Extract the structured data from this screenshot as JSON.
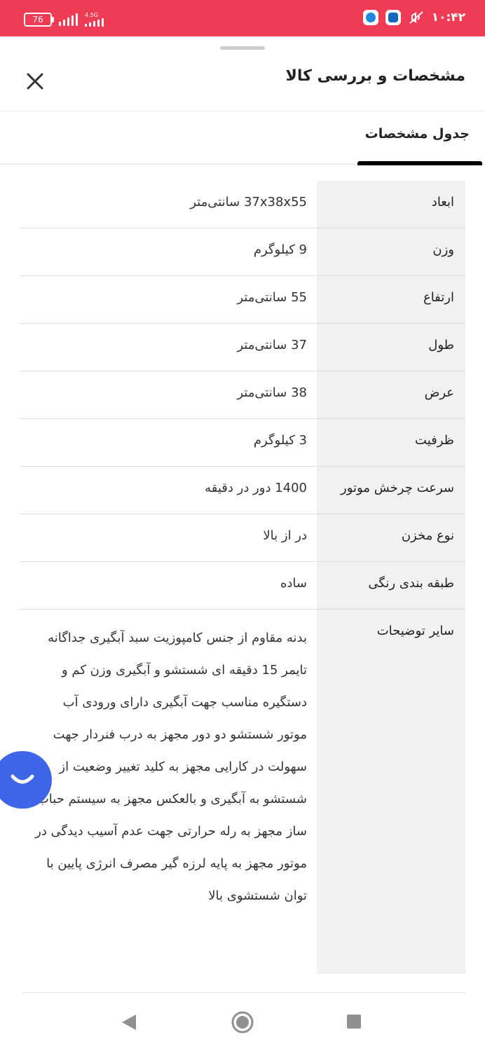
{
  "status_bar": {
    "battery": "76",
    "network": "4.5G",
    "time": "۱۰:۴۲"
  },
  "header": {
    "title": "مشخصات و بررسی کالا"
  },
  "tabs": [
    {
      "label": "جدول مشخصات"
    }
  ],
  "specs": [
    {
      "key": "ابعاد",
      "value": "37x38x55 سانتی‌متر"
    },
    {
      "key": "وزن",
      "value": "9 کیلوگرم"
    },
    {
      "key": "ارتفاع",
      "value": "55 سانتی‌متر"
    },
    {
      "key": "طول",
      "value": "37 سانتی‌متر"
    },
    {
      "key": "عرض",
      "value": "38 سانتی‌متر"
    },
    {
      "key": "ظرفیت",
      "value": "3 کیلوگرم"
    },
    {
      "key": "سرعت چرخش موتور",
      "value": "1400 دور در دقیقه"
    },
    {
      "key": "نوع مخزن",
      "value": "در از بالا"
    },
    {
      "key": "طبقه بندی رنگی",
      "value": "ساده"
    },
    {
      "key": "سایر توضیحات",
      "value": "بدنه مقاوم از جنس کامپوزیت سبد آبگیری جداگانه تایمر 15 دقیقه ای شستشو و آبگیری وزن کم و دستگیره مناسب جهت آبگیری دارای ورودی آب موتور شستشو دو دور مجهز به درب فنردار جهت سهولت در کارایی مجهز به کلید تغییر وضعیت از شستشو به آبگیری و بالعکس مجهز به سیستم حباب ساز مجهز به رله حرارتی جهت عدم آسیب دیدگی در موتور مجهز به پایه لرزه گیر مصرف انرژی پایین با توان شستشوی بالا"
    }
  ],
  "colors": {
    "status_bar": "#ef3b54",
    "fab": "#3f66e8",
    "key_column": "#f1f1f1"
  }
}
